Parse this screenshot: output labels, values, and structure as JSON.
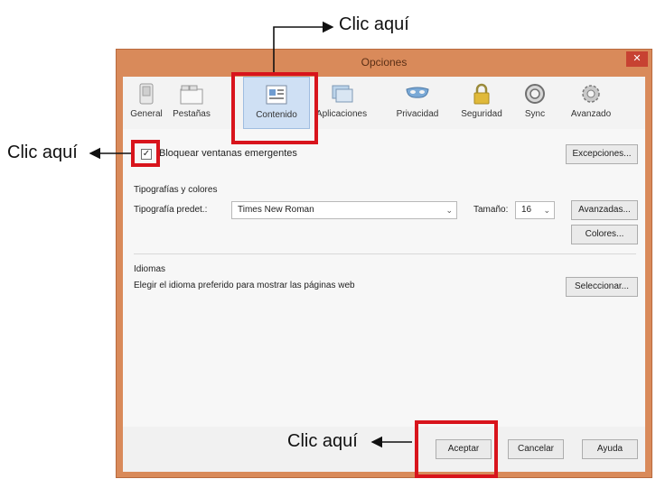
{
  "annotations": {
    "top_label": "Clic aquí",
    "left_label": "Clic aquí",
    "bottom_label": "Clic aquí"
  },
  "window": {
    "title": "Opciones",
    "close_glyph": "✕"
  },
  "toolbar": {
    "items": [
      {
        "label": "General",
        "icon": "general-switch-icon"
      },
      {
        "label": "Pestañas",
        "icon": "tabs-icon"
      },
      {
        "label": "Contenido",
        "icon": "content-icon"
      },
      {
        "label": "Aplicaciones",
        "icon": "applications-icon"
      },
      {
        "label": "Privacidad",
        "icon": "privacy-mask-icon"
      },
      {
        "label": "Seguridad",
        "icon": "padlock-icon"
      },
      {
        "label": "Sync",
        "icon": "sync-icon"
      },
      {
        "label": "Avanzado",
        "icon": "gear-icon"
      }
    ],
    "selected_index": 2
  },
  "content": {
    "popup": {
      "checkbox_checked": true,
      "check_glyph": "✓",
      "label": "Bloquear ventanas emergentes",
      "exceptions_button": "Excepciones..."
    },
    "fonts": {
      "heading": "Tipografías y colores",
      "default_font_label": "Tipografía predet.:",
      "default_font_value": "Times New Roman",
      "size_label": "Tamaño:",
      "size_value": "16",
      "caret": "⌄",
      "advanced_button": "Avanzadas...",
      "colors_button": "Colores..."
    },
    "languages": {
      "heading": "Idiomas",
      "description": "Elegir el idioma preferido para mostrar las páginas web",
      "select_button": "Seleccionar..."
    }
  },
  "footer": {
    "accept_button": "Aceptar",
    "cancel_button": "Cancelar",
    "help_button": "Ayuda"
  },
  "colors": {
    "highlight": "#d8141c",
    "titlebar": "#d98a5a",
    "selected_tab": "#cfe0f4"
  }
}
